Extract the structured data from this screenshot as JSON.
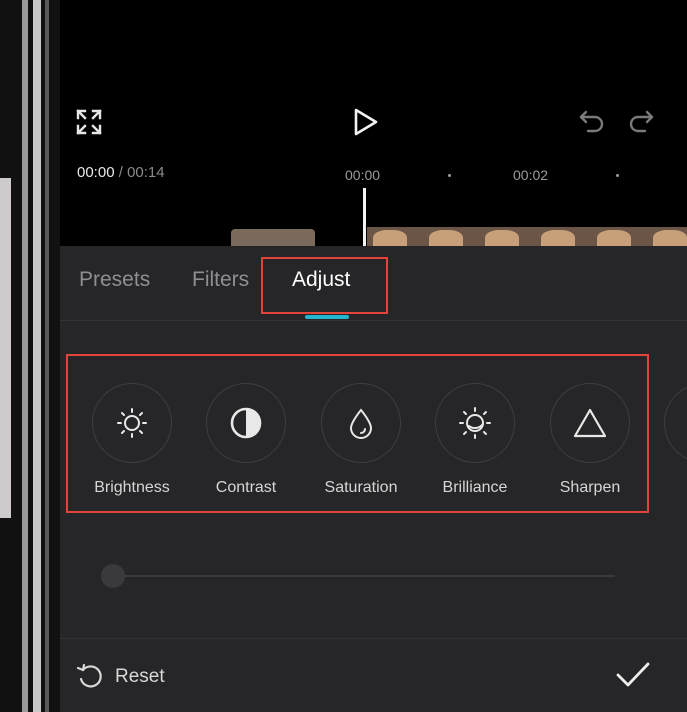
{
  "timeline": {
    "current_time": "00:00",
    "separator": "/",
    "duration": "00:14",
    "ruler_marks": [
      "00:00",
      "00:02"
    ]
  },
  "tabs": [
    {
      "label": "Presets",
      "active": false
    },
    {
      "label": "Filters",
      "active": false
    },
    {
      "label": "Adjust",
      "active": true
    }
  ],
  "adjust_tools": [
    {
      "label": "Brightness",
      "icon": "sun-icon"
    },
    {
      "label": "Contrast",
      "icon": "contrast-icon"
    },
    {
      "label": "Saturation",
      "icon": "droplet-icon"
    },
    {
      "label": "Brilliance",
      "icon": "brilliance-icon"
    },
    {
      "label": "Sharpen",
      "icon": "triangle-icon"
    }
  ],
  "slider": {
    "value": 0
  },
  "footer": {
    "reset_label": "Reset",
    "confirm_icon": "check-icon"
  },
  "colors": {
    "accent": "#25b6cf",
    "highlight": "#e2443b",
    "panel": "#262527"
  }
}
